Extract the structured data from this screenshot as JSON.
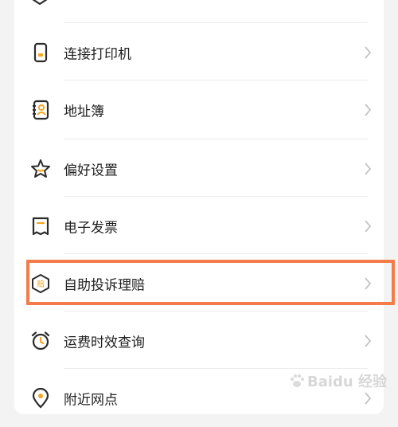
{
  "menu": {
    "items": [
      {
        "label": "连接打印机",
        "icon": "printer-icon"
      },
      {
        "label": "地址簿",
        "icon": "address-book-icon"
      },
      {
        "label": "偏好设置",
        "icon": "star-icon"
      },
      {
        "label": "电子发票",
        "icon": "receipt-icon"
      },
      {
        "label": "自助投诉理赔",
        "icon": "claim-badge-icon",
        "icon_text": "赔",
        "highlighted": true
      },
      {
        "label": "运费时效查询",
        "icon": "alarm-clock-icon"
      },
      {
        "label": "附近网点",
        "icon": "location-pin-icon"
      }
    ]
  },
  "highlight_color": "#f47c4a",
  "accent_color": "#f5a623",
  "watermark": {
    "text": "Baidu 经验"
  }
}
